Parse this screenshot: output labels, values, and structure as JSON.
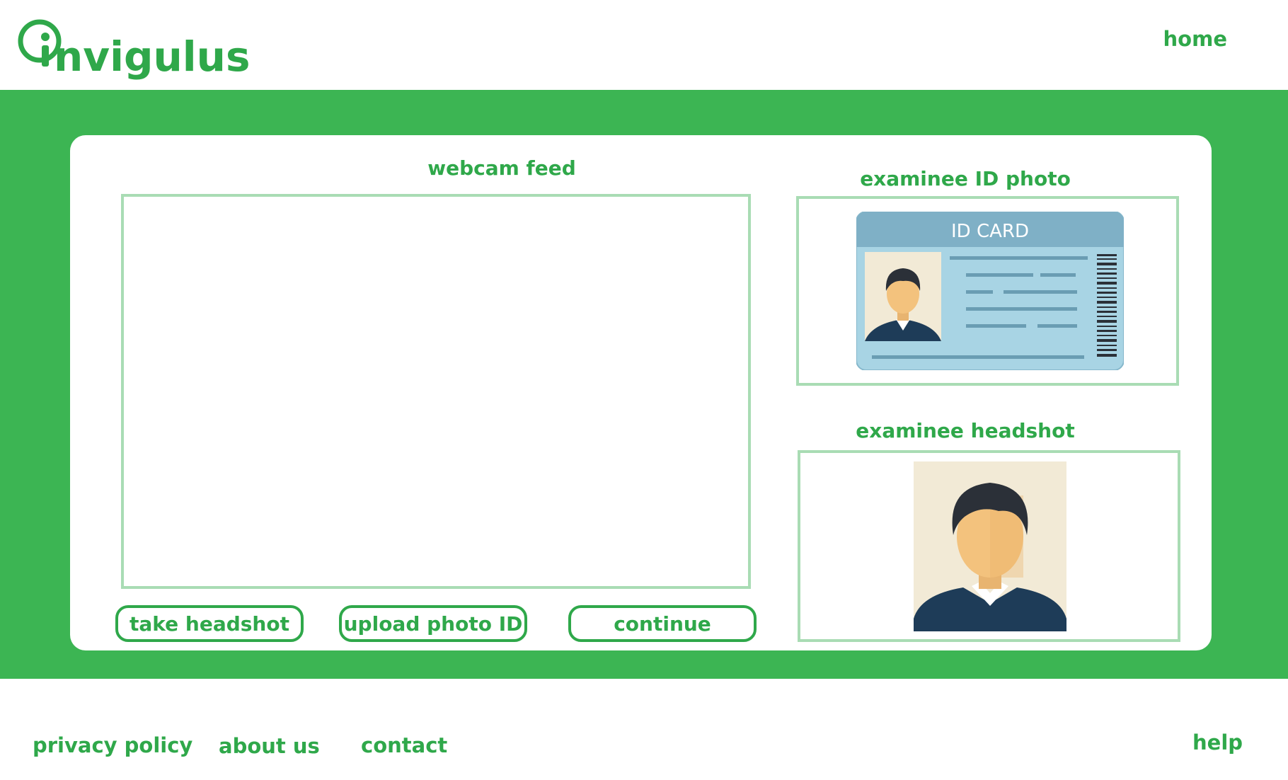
{
  "header": {
    "logo_text": "Invigulus",
    "nav": {
      "home": "home"
    }
  },
  "main": {
    "webcam": {
      "title": "webcam feed"
    },
    "id_photo": {
      "title": "examinee ID photo",
      "card_label": "ID CARD"
    },
    "headshot": {
      "title": "examinee headshot"
    },
    "buttons": {
      "take_headshot": "take headshot",
      "upload_photo_id": "upload photo ID",
      "continue": "continue"
    }
  },
  "footer": {
    "privacy": "privacy policy",
    "about": "about us",
    "contact": "contact",
    "help": "help"
  },
  "colors": {
    "brand_green": "#3cb553",
    "text_green": "#2fa84a",
    "frame_green": "#a9dcb4",
    "id_card_blue": "#a8d4e4",
    "id_card_header": "#7fb0c6"
  }
}
